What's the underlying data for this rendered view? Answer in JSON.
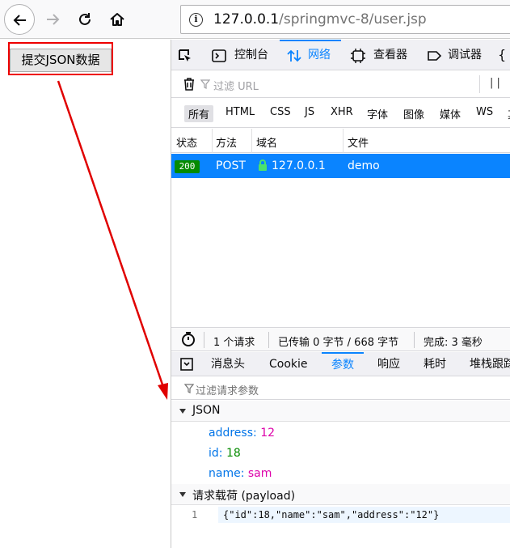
{
  "browser": {
    "url_host": "127.0.0.1",
    "url_path": "/springmvc-8/user.jsp"
  },
  "page": {
    "submit_button_label": "提交JSON数据"
  },
  "devtools": {
    "tabs": [
      {
        "label": "控制台",
        "icon": "console-icon"
      },
      {
        "label": "网络",
        "icon": "network-icon"
      },
      {
        "label": "查看器",
        "icon": "inspector-icon"
      },
      {
        "label": "调试器",
        "icon": "debugger-icon"
      }
    ],
    "filter_placeholder": "过滤 URL",
    "pause_label": "| |",
    "types": [
      "所有",
      "HTML",
      "CSS",
      "JS",
      "XHR",
      "字体",
      "图像",
      "媒体",
      "WS",
      "其"
    ],
    "columns": [
      "状态",
      "方法",
      "域名",
      "文件"
    ],
    "request": {
      "status": "200",
      "method": "POST",
      "domain": "127.0.0.1",
      "file": "demo"
    },
    "summary": {
      "requests": "1 个请求",
      "transferred": "已传输 0 字节 / 668 字节",
      "finish": "完成:  3 毫秒"
    },
    "detail_tabs": [
      "消息头",
      "Cookie",
      "参数",
      "响应",
      "耗时",
      "堆栈跟踪"
    ],
    "param_filter_placeholder": "过滤请求参数",
    "json_section_label": "JSON",
    "params": [
      {
        "key": "address",
        "value": "12"
      },
      {
        "key": "id",
        "value": "18"
      },
      {
        "key": "name",
        "value": "sam"
      }
    ],
    "payload_section_label": "请求载荷 (payload)",
    "payload_line_number": "1",
    "payload_text": "{\"id\":18,\"name\":\"sam\",\"address\":\"12\"}"
  },
  "colors": {
    "accent": "#0a84ff",
    "status_ok": "#058b00",
    "annotation_red": "#e00000"
  }
}
